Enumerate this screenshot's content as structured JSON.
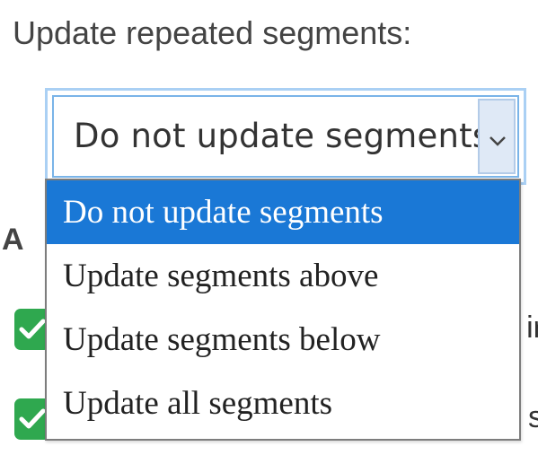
{
  "label": "Update repeated segments:",
  "select": {
    "value": "Do not update segments"
  },
  "background": {
    "column_letter": "A",
    "row_fragments": [
      "ir",
      "s"
    ]
  },
  "dropdown": {
    "options": [
      "Do not update segments",
      "Update segments above",
      "Update segments below",
      "Update all segments"
    ],
    "selected_index": 0
  },
  "colors": {
    "selected_bg": "#1a78d6",
    "checkbox_green": "#2fa84f",
    "focus_border": "#7ab4e8"
  }
}
